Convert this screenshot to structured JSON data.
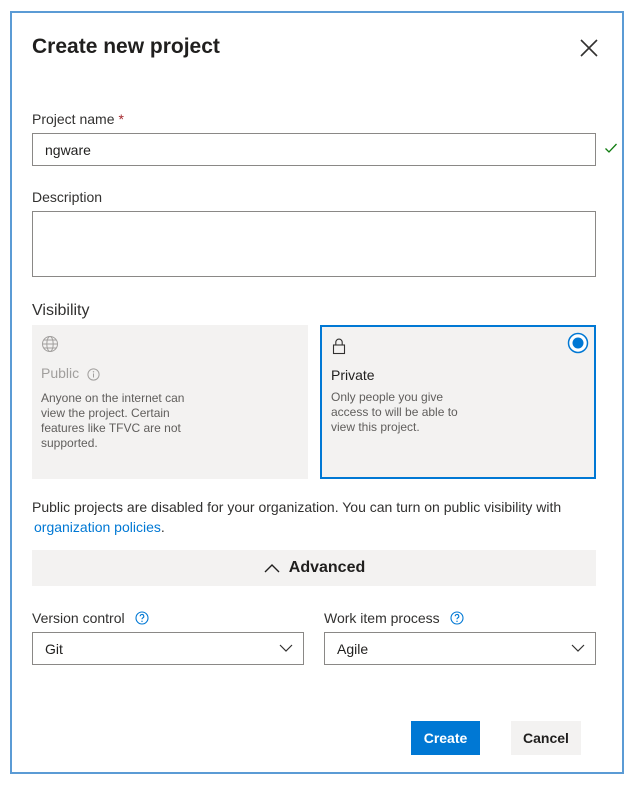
{
  "dialog": {
    "title": "Create new project"
  },
  "project_name": {
    "label": "Project name",
    "required_mark": "*",
    "value": "ngware"
  },
  "description": {
    "label": "Description",
    "value": ""
  },
  "visibility": {
    "label": "Visibility",
    "options": [
      {
        "title": "Public",
        "description": "Anyone on the internet can view the project. Certain features like TFVC are not supported.",
        "selected": false,
        "disabled": true,
        "icon": "globe-icon"
      },
      {
        "title": "Private",
        "description": "Only people you give access to will be able to view this project.",
        "selected": true,
        "disabled": false,
        "icon": "lock-icon"
      }
    ]
  },
  "notice": {
    "text": "Public projects are disabled for your organization. You can turn on public visibility with",
    "link": "organization policies",
    "suffix": "."
  },
  "advanced": {
    "label": "Advanced"
  },
  "version_control": {
    "label": "Version control",
    "value": "Git"
  },
  "work_item_process": {
    "label": "Work item process",
    "value": "Agile"
  },
  "buttons": {
    "create": "Create",
    "cancel": "Cancel"
  },
  "colors": {
    "accent": "#0078d4",
    "success": "#107c10",
    "required": "#a4262c",
    "dialog_border": "#5b9bd5"
  }
}
